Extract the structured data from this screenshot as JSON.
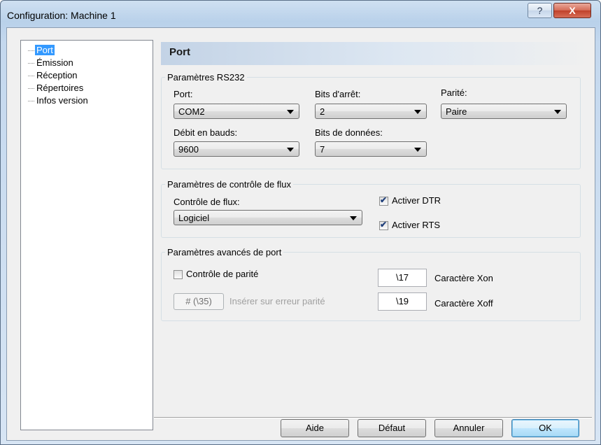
{
  "window": {
    "title": "Configuration: Machine 1",
    "help_glyph": "?",
    "close_glyph": "X"
  },
  "tree": {
    "items": [
      {
        "label": "Port",
        "selected": true
      },
      {
        "label": "Émission"
      },
      {
        "label": "Réception"
      },
      {
        "label": "Répertoires"
      },
      {
        "label": "Infos version"
      }
    ]
  },
  "panel": {
    "title": "Port"
  },
  "rs232": {
    "group_label": "Paramètres RS232",
    "port_label": "Port:",
    "port_value": "COM2",
    "stopbits_label": "Bits d'arrêt:",
    "stopbits_value": "2",
    "parity_label": "Parité:",
    "parity_value": "Paire",
    "baud_label": "Débit en bauds:",
    "baud_value": "9600",
    "databits_label": "Bits de données:",
    "databits_value": "7"
  },
  "flow": {
    "group_label": "Paramètres de contrôle de flux",
    "flow_label": "Contrôle de flux:",
    "flow_value": "Logiciel",
    "dtr_label": "Activer DTR",
    "dtr_checked": true,
    "rts_label": "Activer RTS",
    "rts_checked": true
  },
  "advanced": {
    "group_label": "Paramètres avancés de port",
    "parity_check_label": "Contrôle de parité",
    "parity_check_checked": false,
    "insert_button": "# (\\35)",
    "insert_label": "Insérer sur erreur parité",
    "xon_value": "\\17",
    "xon_label": "Caractère Xon",
    "xoff_value": "\\19",
    "xoff_label": "Caractère Xoff"
  },
  "buttons": {
    "help": "Aide",
    "default": "Défaut",
    "cancel": "Annuler",
    "ok": "OK"
  },
  "check_glyph": "✔"
}
